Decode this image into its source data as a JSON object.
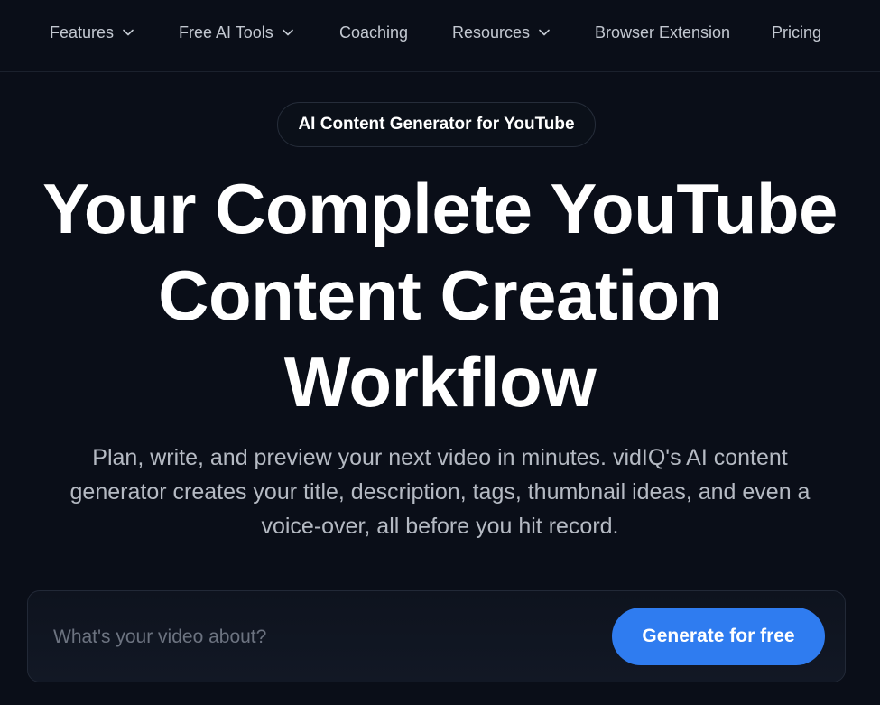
{
  "nav": {
    "items": [
      {
        "label": "Features",
        "has_dropdown": true
      },
      {
        "label": "Free AI Tools",
        "has_dropdown": true
      },
      {
        "label": "Coaching",
        "has_dropdown": false
      },
      {
        "label": "Resources",
        "has_dropdown": true
      },
      {
        "label": "Browser Extension",
        "has_dropdown": false
      },
      {
        "label": "Pricing",
        "has_dropdown": false
      }
    ],
    "dropdown_icon": "chevron-down-icon"
  },
  "hero": {
    "badge": "AI Content Generator for YouTube",
    "headline_lines": [
      "Your Complete YouTube",
      "Content Creation",
      "Workflow"
    ],
    "subtitle_lines": [
      "Plan, write, and preview your next video in minutes. vidIQ's AI content",
      "generator creates your title, description, tags, thumbnail ideas, and even a",
      "voice-over, all before you hit record."
    ]
  },
  "prompt": {
    "placeholder": "What's your video about?",
    "value": "",
    "button_label": "Generate for free"
  },
  "colors": {
    "background": "#0a0e18",
    "accent": "#2f7cf0",
    "nav_text": "#c3c8d1",
    "subtitle_text": "#b5bac3"
  }
}
